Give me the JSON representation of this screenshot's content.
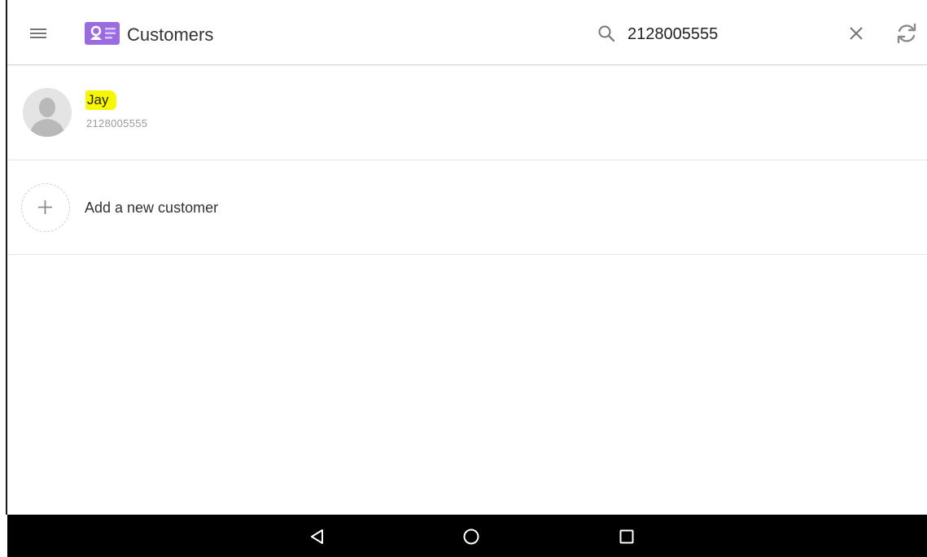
{
  "header": {
    "title": "Customers",
    "search_query": "2128005555",
    "icons": {
      "menu": "hamburger-menu-icon",
      "app": "customer-card-icon",
      "search": "search-icon",
      "clear": "close-icon",
      "refresh": "refresh-icon"
    }
  },
  "results": [
    {
      "name": "Jay",
      "phone": "2128005555",
      "highlight_color": "#f7f700"
    }
  ],
  "add_customer": {
    "label": "Add a new customer",
    "icon": "plus-icon"
  },
  "system_nav": {
    "buttons": [
      "back-icon",
      "home-icon",
      "recents-icon"
    ]
  },
  "colors": {
    "app_icon": "#9b6be0",
    "highlight": "#f7f700",
    "nav_bar": "#000000"
  }
}
